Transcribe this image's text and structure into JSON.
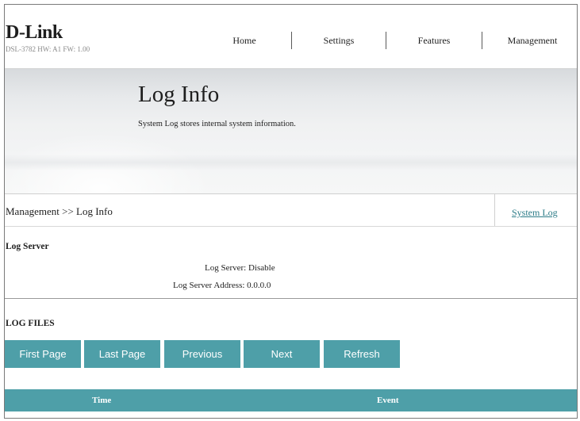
{
  "header": {
    "logo_text": "D-Link",
    "model_line": "DSL-3782  HW: A1  FW: 1.00",
    "nav": [
      "Home",
      "Settings",
      "Features",
      "Management"
    ]
  },
  "banner": {
    "title": "Log Info",
    "description": "System Log stores internal system information."
  },
  "breadcrumb": {
    "path": "Management >> Log Info",
    "link": "System Log"
  },
  "log_server": {
    "heading": "Log Server",
    "server_label": "Log Server: Disable",
    "address_label": "Log Server Address: 0.0.0.0"
  },
  "log_files": {
    "heading": "LOG FILES",
    "buttons": [
      "First Page",
      "Last Page",
      "Previous",
      "Next",
      "Refresh"
    ],
    "columns": [
      "Time",
      "Event"
    ]
  },
  "colors": {
    "accent": "#4e9fa8",
    "link": "#2b7b87"
  }
}
